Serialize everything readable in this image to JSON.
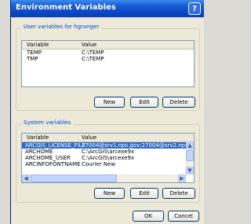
{
  "window": {
    "title": "Environment Variables",
    "help_label": "?"
  },
  "user_vars": {
    "group_title": "User variables for hgranger",
    "columns": [
      "Variable",
      "Value"
    ],
    "rows": [
      {
        "name": "TEMP",
        "value": "C:\\TEMP"
      },
      {
        "name": "TMP",
        "value": "C:\\TEMP"
      }
    ],
    "buttons": {
      "new": "New",
      "edit": "Edit",
      "delete": "Delete"
    }
  },
  "system_vars": {
    "group_title": "System variables",
    "columns": [
      "Variable",
      "Value"
    ],
    "rows": [
      {
        "name": "ARCGIS_LICENSE_FILE",
        "value": "27004@srv1.nps.gov;27004@srv2.np",
        "selected": true
      },
      {
        "name": "ARCHOME",
        "value": "C:\\ArcGIS\\arcexe9x",
        "selected": false
      },
      {
        "name": "ARCHOME_USER",
        "value": "C:\\ArcGIS\\arcexe9x",
        "selected": false
      },
      {
        "name": "ARCINFOFONTNAME",
        "value": "Courier New",
        "selected": false
      }
    ],
    "buttons": {
      "new": "New",
      "edit": "Edit",
      "delete": "Delete"
    }
  },
  "footer": {
    "ok": "OK",
    "cancel": "Cancel"
  },
  "icons": {
    "scroll_up": "up-arrow-icon",
    "scroll_down": "down-arrow-icon",
    "scroll_left": "left-arrow-icon",
    "scroll_right": "right-arrow-icon"
  },
  "colors": {
    "title_bar": "#0a47c9",
    "selection": "#316ac5",
    "group_title": "#0046d5"
  }
}
